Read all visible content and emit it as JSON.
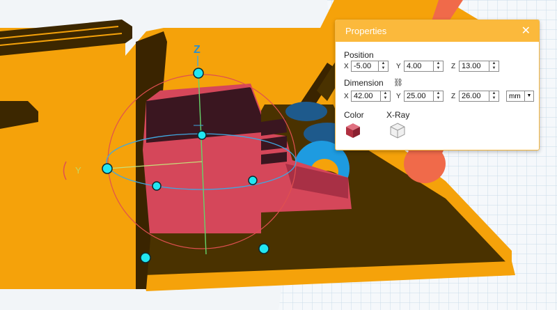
{
  "viewport": {
    "gizmo": {
      "z_axis_label": "Z",
      "y_axis_label": "Y"
    },
    "colors": {
      "object_body": "#f5a20a",
      "object_shadow": "#4a3200",
      "selected": "#d5475a",
      "selected_dark": "#3a1620",
      "cylinder": "#1e9be0",
      "cylinder_inner": "#f5a20a",
      "coral": "#f06a4a",
      "grid_bg": "#f5f8fb",
      "grid_line": "#c9dce8",
      "handle": "#22e6f2"
    }
  },
  "properties": {
    "title": "Properties",
    "close_icon": "close-icon",
    "position": {
      "label": "Position",
      "x_label": "X",
      "x_value": "-5.00",
      "y_label": "Y",
      "y_value": "4.00",
      "z_label": "Z",
      "z_value": "13.00"
    },
    "dimension": {
      "label": "Dimension",
      "lock_icon": "link-icon",
      "x_label": "X",
      "x_value": "42.00",
      "y_label": "Y",
      "y_value": "25.00",
      "z_label": "Z",
      "z_value": "26.00",
      "unit": "mm"
    },
    "color": {
      "label": "Color",
      "value": "#c23a4c"
    },
    "xray": {
      "label": "X-Ray"
    }
  }
}
